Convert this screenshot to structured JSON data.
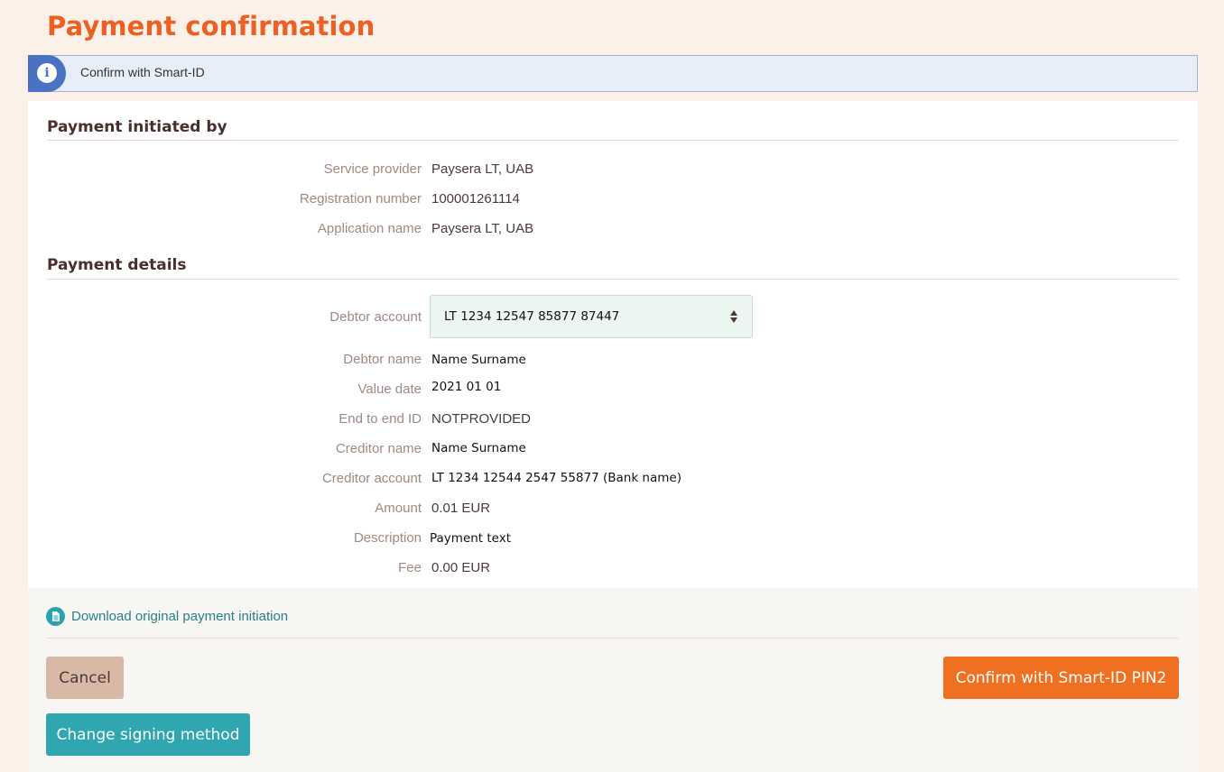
{
  "page_title": "Payment confirmation",
  "info_banner": {
    "text": "Confirm with Smart-ID",
    "icon": "info-icon"
  },
  "initiated_by": {
    "title": "Payment initiated by",
    "rows": [
      {
        "label": "Service provider",
        "value": "Paysera LT, UAB"
      },
      {
        "label": "Registration number",
        "value": "100001261114"
      },
      {
        "label": "Application name",
        "value": "Paysera LT, UAB"
      }
    ]
  },
  "payment_details": {
    "title": "Payment details",
    "debtor_account": {
      "label": "Debtor account",
      "selected": "LT 1234 12547 85877 87447"
    },
    "rows": [
      {
        "label": "Debtor name",
        "value": "Name Surname"
      },
      {
        "label": "Value date",
        "value": "2021 01 01"
      },
      {
        "label": "End to end ID",
        "value": "NOTPROVIDED"
      },
      {
        "label": "Creditor name",
        "value": "Name Surname"
      },
      {
        "label": "Creditor account",
        "value": "LT 1234 12544 2547 55877 (Bank name)"
      },
      {
        "label": "Amount",
        "value": "0.01 EUR"
      },
      {
        "label": "Description",
        "value": "Payment text"
      },
      {
        "label": "Fee",
        "value": "0.00 EUR"
      }
    ]
  },
  "download_link": {
    "label": "Download original payment initiation",
    "icon": "document-icon"
  },
  "buttons": {
    "cancel": "Cancel",
    "confirm": "Confirm with Smart-ID PIN2",
    "change_method": "Change signing method"
  },
  "colors": {
    "page_bg": "#fbf1e8",
    "title": "#ee5f24",
    "info_accent": "#4a72c3",
    "confirm_button": "#ef7021",
    "change_button": "#2fa6b0",
    "cancel_button": "#d8b9a6"
  }
}
